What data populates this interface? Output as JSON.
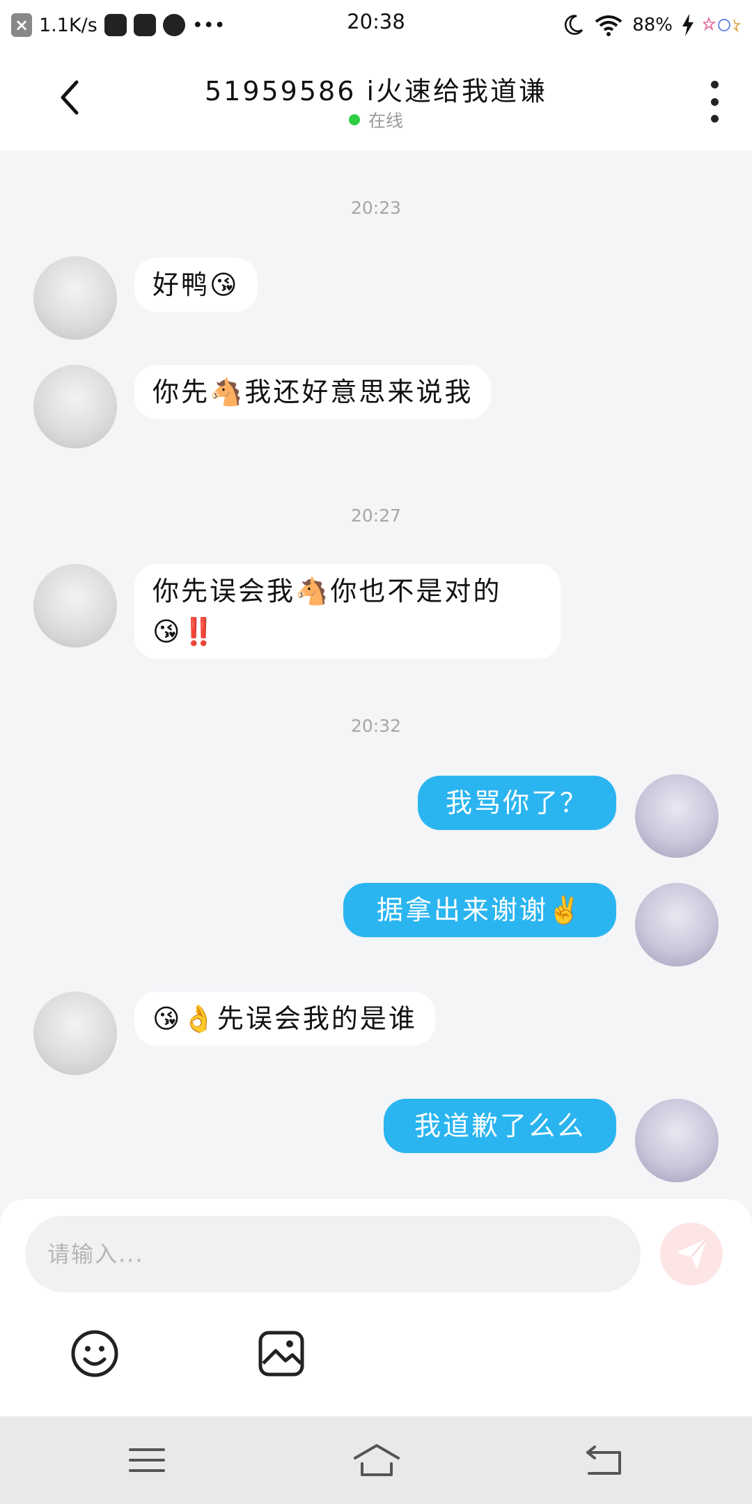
{
  "status_bar": {
    "speed": "1.1K/s",
    "time": "20:38",
    "battery": "88%",
    "close_glyph": "×",
    "more_glyph": "•••"
  },
  "header": {
    "title": "51959586 i火速给我道谦",
    "status": "在线"
  },
  "messages": [
    {
      "type": "time",
      "text": "20:23"
    },
    {
      "type": "in",
      "text": "好鸭😘"
    },
    {
      "type": "in",
      "text": "你先🐴我还好意思来说我"
    },
    {
      "type": "time",
      "text": "20:27"
    },
    {
      "type": "in",
      "text": "你先误会我🐴你也不是对的😘‼️"
    },
    {
      "type": "time",
      "text": "20:32"
    },
    {
      "type": "out",
      "text": "我骂你了？"
    },
    {
      "type": "out",
      "text": "据拿出来谢谢✌️"
    },
    {
      "type": "in",
      "text": "😘👌先误会我的是谁"
    },
    {
      "type": "out",
      "text": "我道歉了么么"
    }
  ],
  "composer": {
    "placeholder": "请输入..."
  },
  "icons": {
    "back": "chevron-left-icon",
    "more": "more-vertical-icon",
    "send": "send-icon",
    "emoji": "smiley-icon",
    "image": "image-icon",
    "menu": "menu-icon",
    "home": "home-icon",
    "return": "back-arrow-icon"
  },
  "colors": {
    "outgoing_bubble": "#2bb5f0",
    "incoming_bubble": "#ffffff",
    "online_dot": "#2ecc40",
    "send_button": "#fde5e5"
  }
}
